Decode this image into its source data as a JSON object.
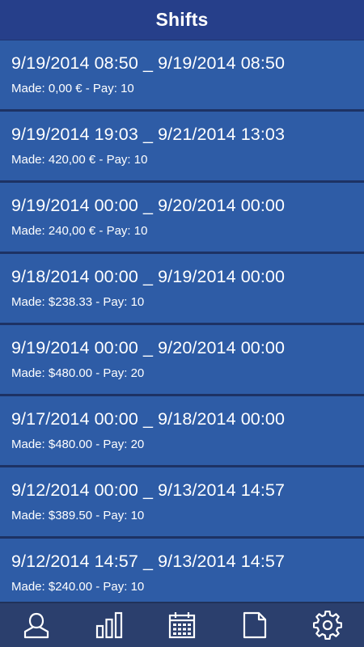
{
  "header": {
    "title": "Shifts"
  },
  "shifts": [
    {
      "range": "9/19/2014 08:50 _ 9/19/2014 08:50",
      "summary": "Made: 0,00 € - Pay: 10"
    },
    {
      "range": "9/19/2014 19:03 _ 9/21/2014 13:03",
      "summary": "Made: 420,00 € - Pay: 10"
    },
    {
      "range": "9/19/2014 00:00 _ 9/20/2014 00:00",
      "summary": "Made: 240,00 € - Pay: 10"
    },
    {
      "range": "9/18/2014 00:00 _ 9/19/2014 00:00",
      "summary": "Made: $238.33 - Pay: 10"
    },
    {
      "range": "9/19/2014 00:00 _ 9/20/2014 00:00",
      "summary": "Made: $480.00 - Pay: 20"
    },
    {
      "range": "9/17/2014 00:00 _ 9/18/2014 00:00",
      "summary": "Made: $480.00 - Pay: 20"
    },
    {
      "range": "9/12/2014 00:00 _ 9/13/2014 14:57",
      "summary": "Made: $389.50 - Pay: 10"
    },
    {
      "range": "9/12/2014 14:57 _ 9/13/2014 14:57",
      "summary": "Made: $240.00 - Pay: 10"
    }
  ],
  "bottom_nav": [
    {
      "icon": "user-icon"
    },
    {
      "icon": "bar-chart-icon"
    },
    {
      "icon": "calendar-icon"
    },
    {
      "icon": "document-icon"
    },
    {
      "icon": "gear-icon"
    }
  ],
  "colors": {
    "header_bg": "#263f8a",
    "item_bg": "#2e5ca6",
    "separator": "#1d3264",
    "bottom_bar_bg": "#2b3f6d",
    "text": "#ffffff"
  }
}
